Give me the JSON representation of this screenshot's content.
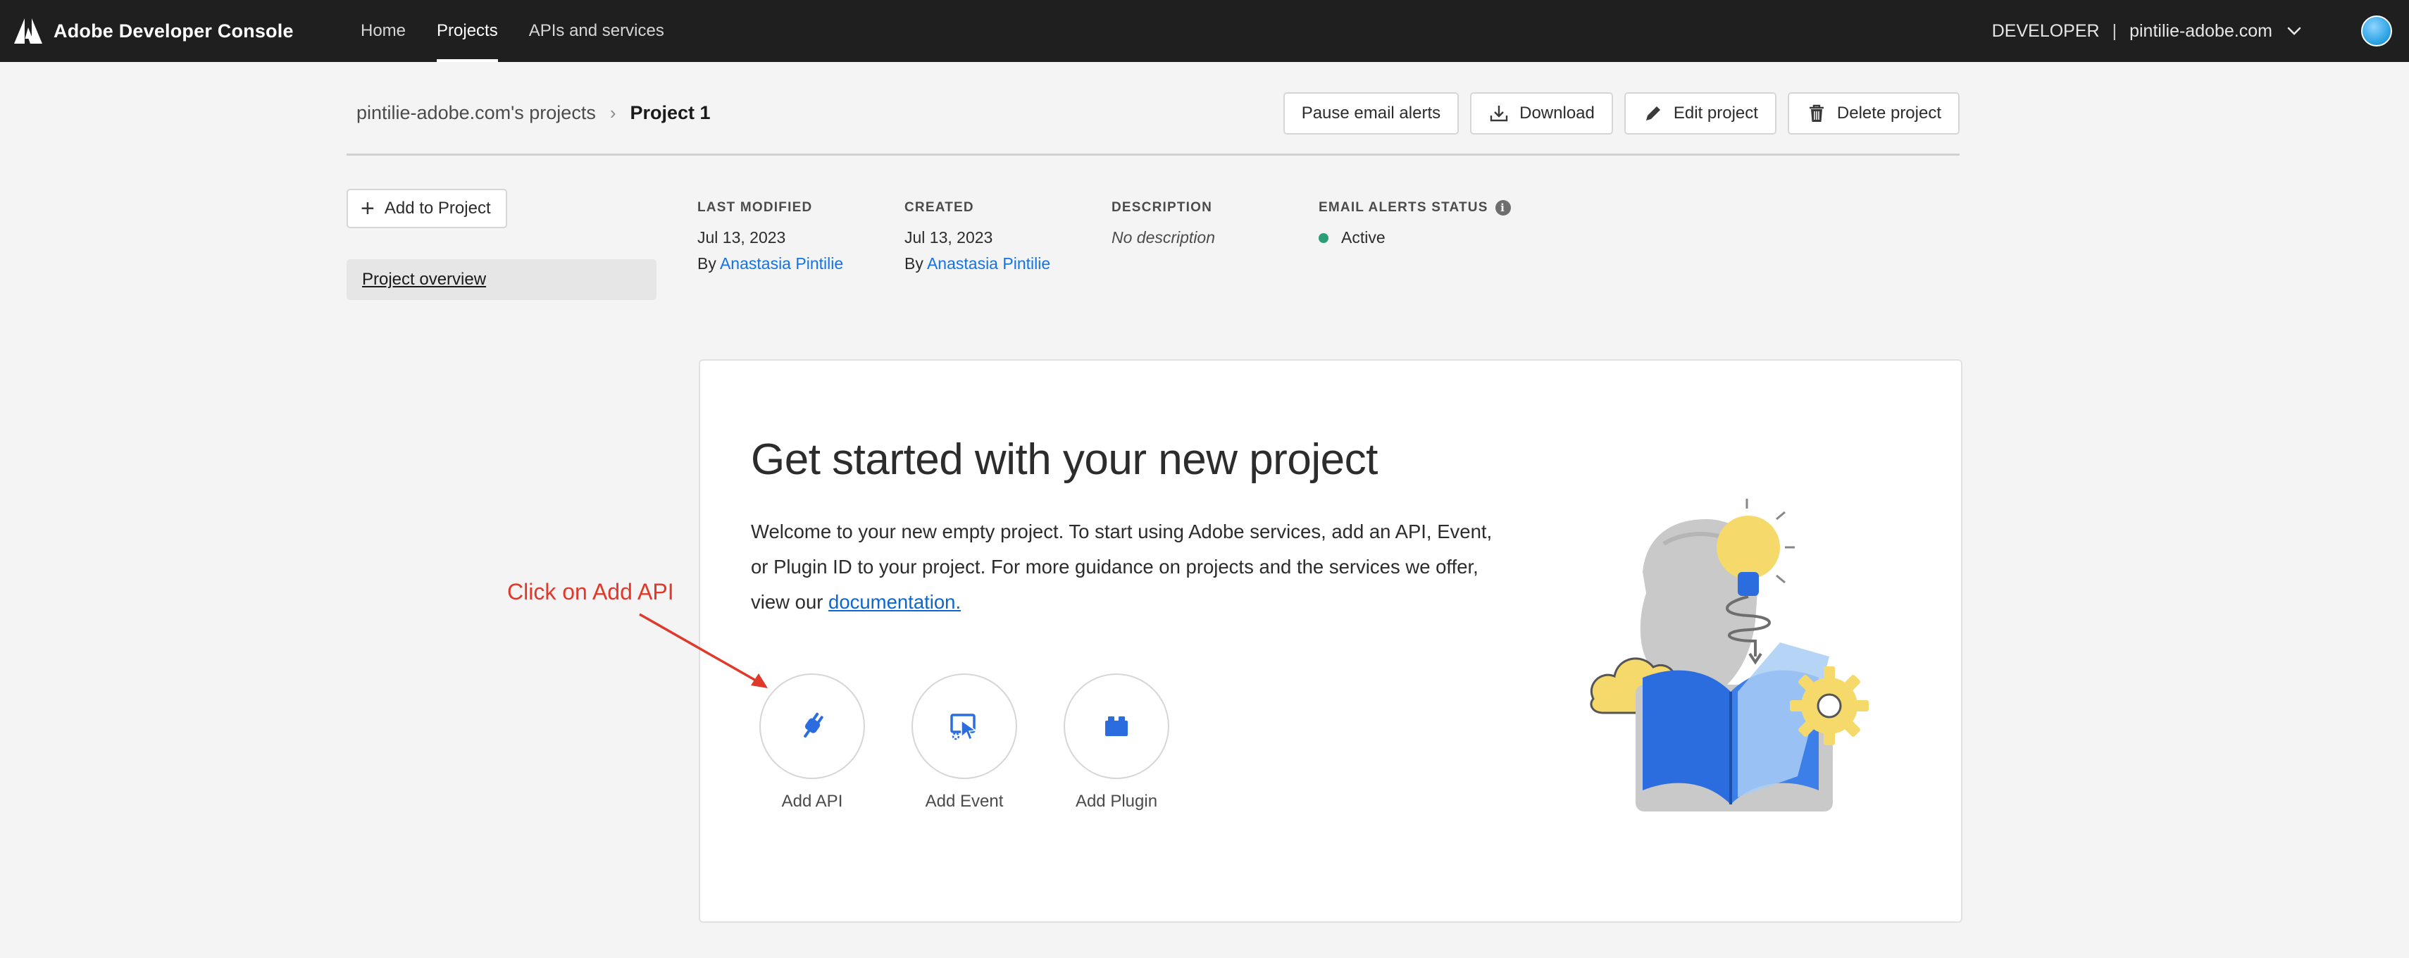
{
  "app": {
    "brand_name": "Adobe Developer Console",
    "logo_icon": "adobe-logo-icon"
  },
  "nav": {
    "items": [
      {
        "label": "Home",
        "active": false
      },
      {
        "label": "Projects",
        "active": true
      },
      {
        "label": "APIs and services",
        "active": false
      }
    ]
  },
  "org": {
    "role": "DEVELOPER",
    "separator": "|",
    "name": "pintilie-adobe.com",
    "chevron_icon": "chevron-down-icon"
  },
  "breadcrumb": {
    "parent": "pintilie-adobe.com's projects",
    "separator": "›",
    "current": "Project 1"
  },
  "actions": {
    "pause_alerts": "Pause email alerts",
    "download": "Download",
    "edit": "Edit project",
    "delete": "Delete project"
  },
  "sidebar": {
    "add_button": "Add to Project",
    "items": [
      {
        "label": "Project overview",
        "selected": true
      }
    ]
  },
  "meta": {
    "last_modified": {
      "label": "LAST MODIFIED",
      "date": "Jul 13, 2023",
      "by_prefix": "By",
      "by_name": "Anastasia Pintilie"
    },
    "created": {
      "label": "CREATED",
      "date": "Jul 13, 2023",
      "by_prefix": "By",
      "by_name": "Anastasia Pintilie"
    },
    "description": {
      "label": "DESCRIPTION",
      "value": "No description"
    },
    "email_alerts": {
      "label": "EMAIL ALERTS STATUS",
      "info": "i",
      "value": "Active",
      "status_color": "#2d9d78"
    }
  },
  "card": {
    "title": "Get started with your new project",
    "body": "Welcome to your new empty project. To start using Adobe services, add an API, Event, or Plugin ID to your project. For more guidance on projects and the services we offer, view our ",
    "link": "documentation.",
    "tiles": [
      {
        "label": "Add API",
        "icon": "plug-icon"
      },
      {
        "label": "Add Event",
        "icon": "event-cursor-icon"
      },
      {
        "label": "Add Plugin",
        "icon": "plugin-block-icon"
      }
    ]
  },
  "annotation": {
    "text": "Click on Add API",
    "color": "#e0392b"
  },
  "colors": {
    "topbar": "#1f1f1f",
    "accent_blue": "#1473e6",
    "icon_blue": "#2b6ddf"
  }
}
